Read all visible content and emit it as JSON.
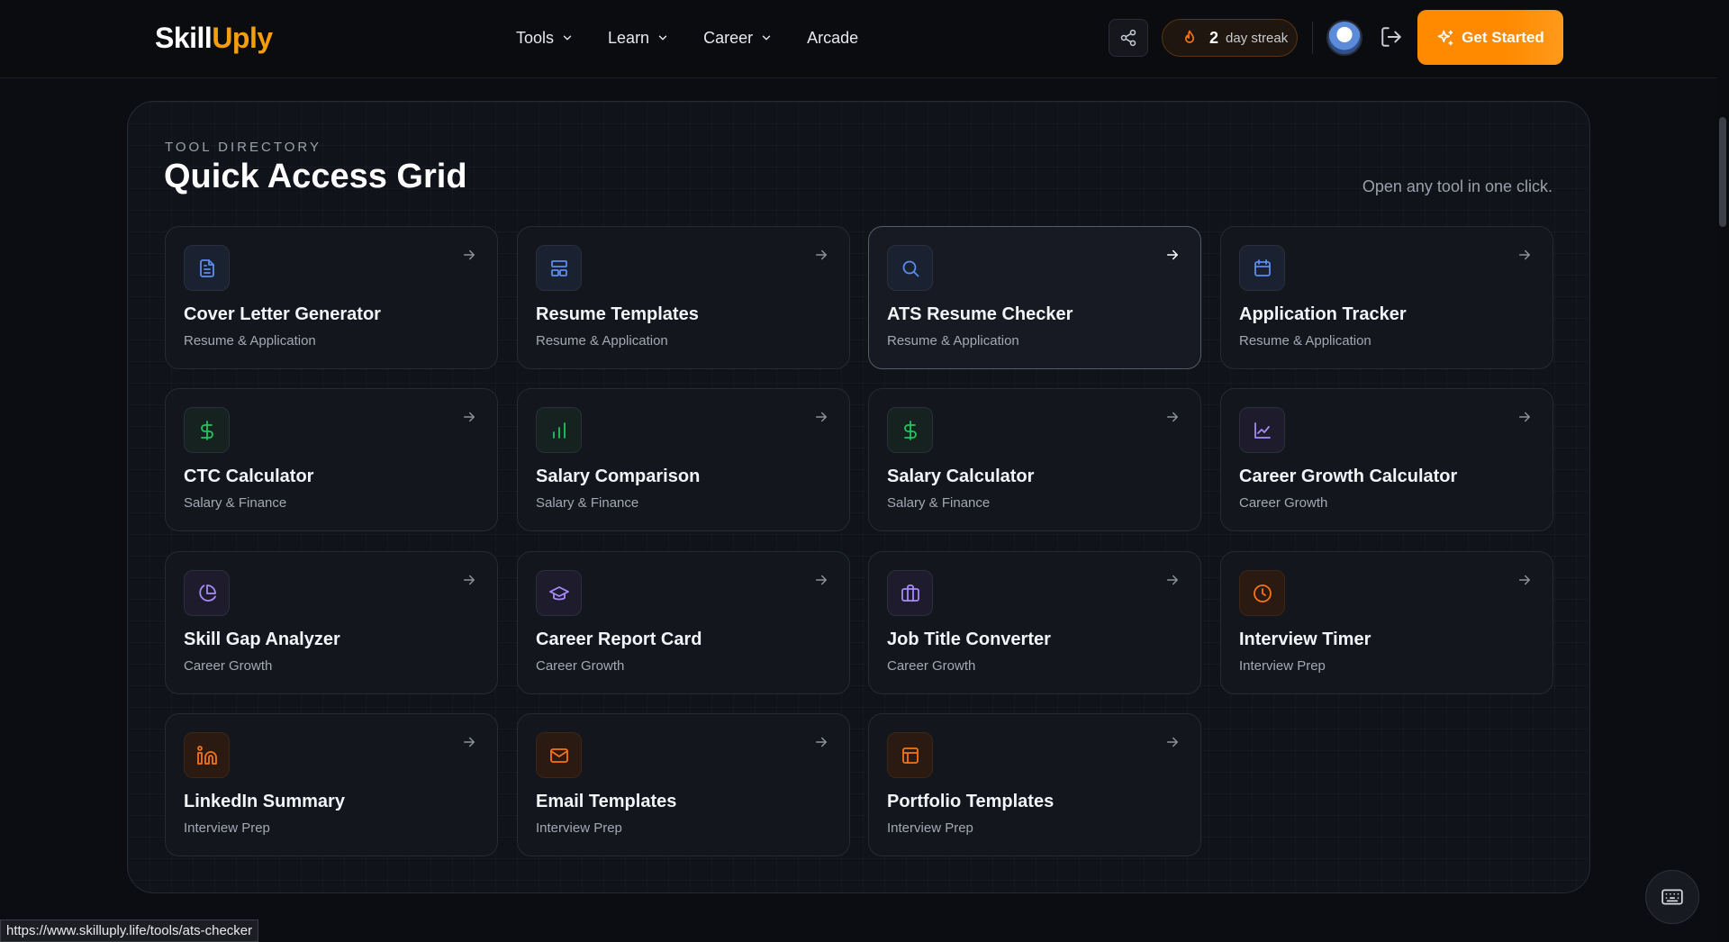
{
  "brand": {
    "part1": "Skill",
    "part2": "Uply"
  },
  "nav": {
    "links": [
      {
        "label": "Tools",
        "dropdown": true
      },
      {
        "label": "Learn",
        "dropdown": true
      },
      {
        "label": "Career",
        "dropdown": true
      },
      {
        "label": "Arcade",
        "dropdown": false
      }
    ],
    "streak_count": "2",
    "streak_label": "day streak",
    "cta_label": "Get Started"
  },
  "section": {
    "eyebrow": "TOOL DIRECTORY",
    "title": "Quick Access Grid",
    "subtitle": "Open any tool in one click."
  },
  "tools": [
    {
      "name": "Cover Letter Generator",
      "category": "Resume & Application",
      "icon": "document-icon",
      "color": "blue"
    },
    {
      "name": "Resume Templates",
      "category": "Resume & Application",
      "icon": "layout-icon",
      "color": "blue"
    },
    {
      "name": "ATS Resume Checker",
      "category": "Resume & Application",
      "icon": "search-icon",
      "color": "blue",
      "active": true
    },
    {
      "name": "Application Tracker",
      "category": "Resume & Application",
      "icon": "calendar-icon",
      "color": "blue"
    },
    {
      "name": "CTC Calculator",
      "category": "Salary & Finance",
      "icon": "dollar-icon",
      "color": "green"
    },
    {
      "name": "Salary Comparison",
      "category": "Salary & Finance",
      "icon": "bar-chart-icon",
      "color": "green"
    },
    {
      "name": "Salary Calculator",
      "category": "Salary & Finance",
      "icon": "dollar-icon",
      "color": "green"
    },
    {
      "name": "Career Growth Calculator",
      "category": "Career Growth",
      "icon": "line-chart-icon",
      "color": "purple"
    },
    {
      "name": "Skill Gap Analyzer",
      "category": "Career Growth",
      "icon": "pie-chart-icon",
      "color": "purple"
    },
    {
      "name": "Career Report Card",
      "category": "Career Growth",
      "icon": "graduation-cap-icon",
      "color": "purple"
    },
    {
      "name": "Job Title Converter",
      "category": "Career Growth",
      "icon": "briefcase-icon",
      "color": "purple"
    },
    {
      "name": "Interview Timer",
      "category": "Interview Prep",
      "icon": "clock-icon",
      "color": "orange"
    },
    {
      "name": "LinkedIn Summary",
      "category": "Interview Prep",
      "icon": "linkedin-icon",
      "color": "orange"
    },
    {
      "name": "Email Templates",
      "category": "Interview Prep",
      "icon": "mail-icon",
      "color": "orange"
    },
    {
      "name": "Portfolio Templates",
      "category": "Interview Prep",
      "icon": "layout-panel-icon",
      "color": "orange"
    }
  ],
  "status_url": "https://www.skilluply.life/tools/ats-checker",
  "colors": {
    "accent": "#ff8a00",
    "brand_orange": "#f59e0b",
    "blue": "#5b8def",
    "green": "#22c55e",
    "purple": "#a78bfa",
    "orange": "#f97316"
  }
}
